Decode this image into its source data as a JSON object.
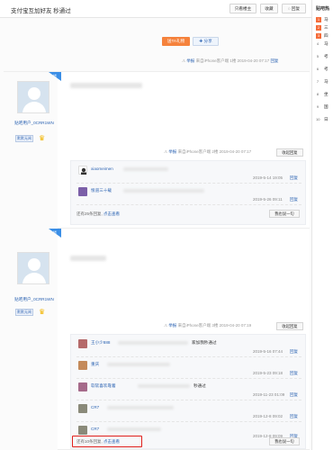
{
  "header": {
    "title": "支付宝互加好友 秒通过",
    "buttons": [
      "只看楼主",
      "收藏",
      "回复"
    ]
  },
  "right_panel": {
    "title": "贴吧热",
    "items": [
      {
        "rank": "1",
        "text": "马"
      },
      {
        "rank": "2",
        "text": "三"
      },
      {
        "rank": "3",
        "text": "四"
      },
      {
        "rank": "4",
        "text": "马"
      },
      {
        "rank": "5",
        "text": "考"
      },
      {
        "rank": "6",
        "text": "考"
      },
      {
        "rank": "7",
        "text": "马"
      },
      {
        "rank": "8",
        "text": "坐"
      },
      {
        "rank": "9",
        "text": "国"
      },
      {
        "rank": "10",
        "text": "日"
      }
    ]
  },
  "first_post": {
    "orange_button": "送TA礼物",
    "share_button": "分享",
    "report": "举报",
    "client": "来自iPhone客户端",
    "floor": "1楼",
    "time": "2019-04-20 07:17",
    "reply": "回复"
  },
  "posts": [
    {
      "username": "贴吧用户_0CRR1WN",
      "level_label": "默默无闻",
      "badge": "楼",
      "report": "举报",
      "client": "来自iPhone客户端",
      "floor": "2楼",
      "time": "2019-04-20 07:17",
      "collapse": "收起回复",
      "replies": [
        {
          "user": "xiaomeimen",
          "text": "",
          "time": "2019-5-14 19:05",
          "reply": "回复",
          "avatar_color": "#6a6a6a"
        },
        {
          "user": "恨道三十载",
          "text": "",
          "time": "2019-5-26 09:11",
          "reply": "回复",
          "avatar_color": "#7b5fa8"
        }
      ],
      "more_prefix": "还有25条回复,",
      "more_link": "点击查看",
      "say_button": "我也说一句"
    },
    {
      "username": "贴吧用户_0CRR1WN",
      "level_label": "默默无闻",
      "badge": "楼",
      "report": "举报",
      "client": "来自iPhone客户端",
      "floor": "3楼",
      "time": "2019-04-20 07:19",
      "collapse": "收起回复",
      "replies": [
        {
          "user": "王小少888",
          "text": "家加我秒通过",
          "time": "2019-5-16 07:44",
          "reply": "回复",
          "avatar_color": "#b56a6a"
        },
        {
          "user": "重庆",
          "text": "",
          "time": "2019-5-23 09:18",
          "reply": "回复",
          "avatar_color": "#c48a5a"
        },
        {
          "user": "软软喜欢靠着",
          "text": "秒通过",
          "time": "2019-11-23 01:09",
          "reply": "回复",
          "avatar_color": "#a56a8a"
        },
        {
          "user": "CR7",
          "text": "",
          "time": "2019-12-8 09:02",
          "reply": "回复",
          "avatar_color": "#8a8a7a"
        },
        {
          "user": "CR7",
          "text": "",
          "time": "2019-12-8 09:09",
          "reply": "回复",
          "avatar_color": "#8a8a7a"
        }
      ],
      "more_prefix": "还有10条回复,",
      "more_link": "点击查看",
      "say_button": "我也说一句"
    }
  ]
}
